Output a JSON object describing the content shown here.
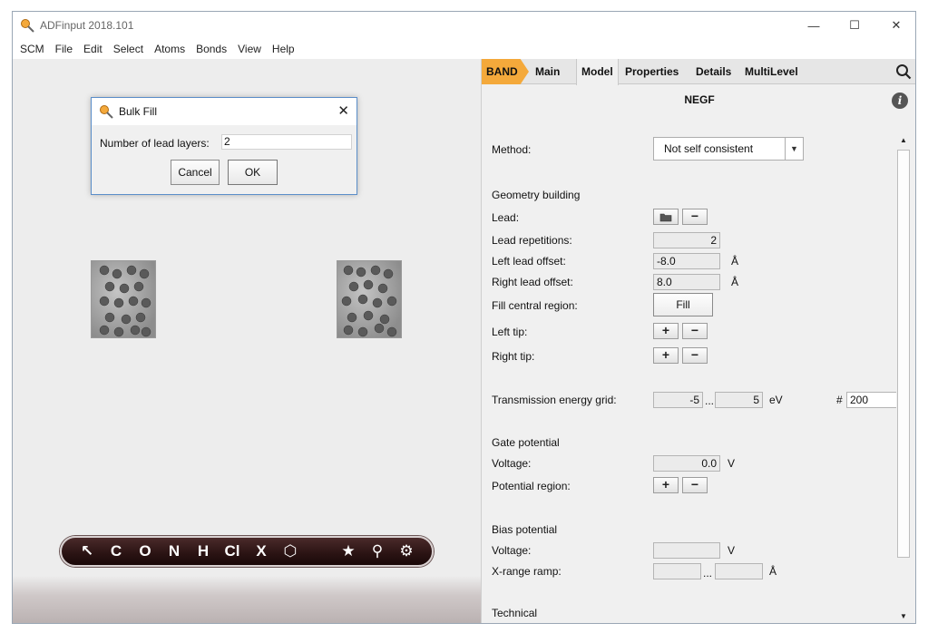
{
  "window": {
    "title": "ADFinput 2018.101",
    "minimize": "—",
    "maximize": "☐",
    "close": "✕"
  },
  "menu": [
    "SCM",
    "File",
    "Edit",
    "Select",
    "Atoms",
    "Bonds",
    "View",
    "Help"
  ],
  "toolbar": {
    "tools": [
      "↖",
      "C",
      "O",
      "N",
      "H",
      "Cl",
      "X",
      "⬡",
      "★",
      "⚲",
      "⚙"
    ]
  },
  "tabs": {
    "band": "BAND",
    "main": "Main",
    "model": "Model",
    "properties": "Properties",
    "details": "Details",
    "multilevel": "MultiLevel"
  },
  "panel": {
    "section_title": "NEGF",
    "info": "i",
    "method_label": "Method:",
    "method_value": "Not self consistent",
    "geometry_heading": "Geometry building",
    "lead_label": "Lead:",
    "lead_repetitions_label": "Lead repetitions:",
    "lead_repetitions_value": "2",
    "left_lead_offset_label": "Left lead offset:",
    "left_lead_offset_value": "-8.0",
    "right_lead_offset_label": "Right lead offset:",
    "right_lead_offset_value": "8.0",
    "angstrom": "Å",
    "fill_central_label": "Fill central region:",
    "fill_button": "Fill",
    "left_tip_label": "Left tip:",
    "right_tip_label": "Right tip:",
    "plus": "+",
    "minus": "−",
    "transmission_label": "Transmission energy grid:",
    "transmission_from": "-5",
    "transmission_to": "5",
    "range_sep": "...",
    "ev": "eV",
    "hash": "#",
    "transmission_count": "200",
    "gate_heading": "Gate potential",
    "gate_voltage_label": "Voltage:",
    "gate_voltage_value": "0.0",
    "volt": "V",
    "potential_region_label": "Potential region:",
    "bias_heading": "Bias potential",
    "bias_voltage_label": "Voltage:",
    "bias_voltage_value": "",
    "xrange_label": "X-range ramp:",
    "xrange_from": "",
    "xrange_to": "",
    "technical_heading": "Technical"
  },
  "dialog": {
    "title": "Bulk Fill",
    "close": "✕",
    "label": "Number of lead layers:",
    "value": "2",
    "cancel": "Cancel",
    "ok": "OK"
  },
  "colors": {
    "band_tab": "#f4a93b",
    "toolbar_bg": "#2a1313",
    "dialog_border": "#5b8ec9"
  }
}
